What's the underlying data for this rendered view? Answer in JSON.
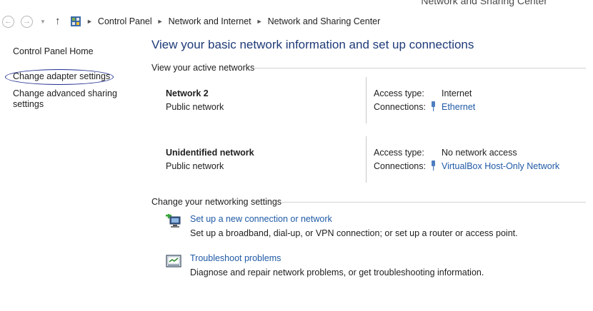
{
  "window": {
    "title": "Network and Sharing Center"
  },
  "address_bar": {
    "breadcrumbs": [
      "Control Panel",
      "Network and Internet",
      "Network and Sharing Center"
    ]
  },
  "sidebar": {
    "items": [
      {
        "label": "Control Panel Home"
      },
      {
        "label": "Change adapter settings"
      },
      {
        "label": "Change advanced sharing settings"
      }
    ]
  },
  "main": {
    "title": "View your basic network information and set up connections",
    "active_networks_heading": "View your active networks",
    "networks": [
      {
        "name": "Network  2",
        "type": "Public network",
        "access_label": "Access type:",
        "access_value": "Internet",
        "connections_label": "Connections:",
        "connection": "Ethernet"
      },
      {
        "name": "Unidentified network",
        "type": "Public network",
        "access_label": "Access type:",
        "access_value": "No network access",
        "connections_label": "Connections:",
        "connection": "VirtualBox Host-Only Network"
      }
    ],
    "settings_heading": "Change your networking settings",
    "tasks": [
      {
        "link": "Set up a new connection or network",
        "description": "Set up a broadband, dial-up, or VPN connection; or set up a router or access point.",
        "icon": "new-connection-icon"
      },
      {
        "link": "Troubleshoot problems",
        "description": "Diagnose and repair network problems, or get troubleshooting information.",
        "icon": "troubleshoot-icon"
      }
    ]
  },
  "colors": {
    "link": "#1f5aa6",
    "title": "#1e3a78",
    "annotation_circle": "#1f2c8f"
  }
}
